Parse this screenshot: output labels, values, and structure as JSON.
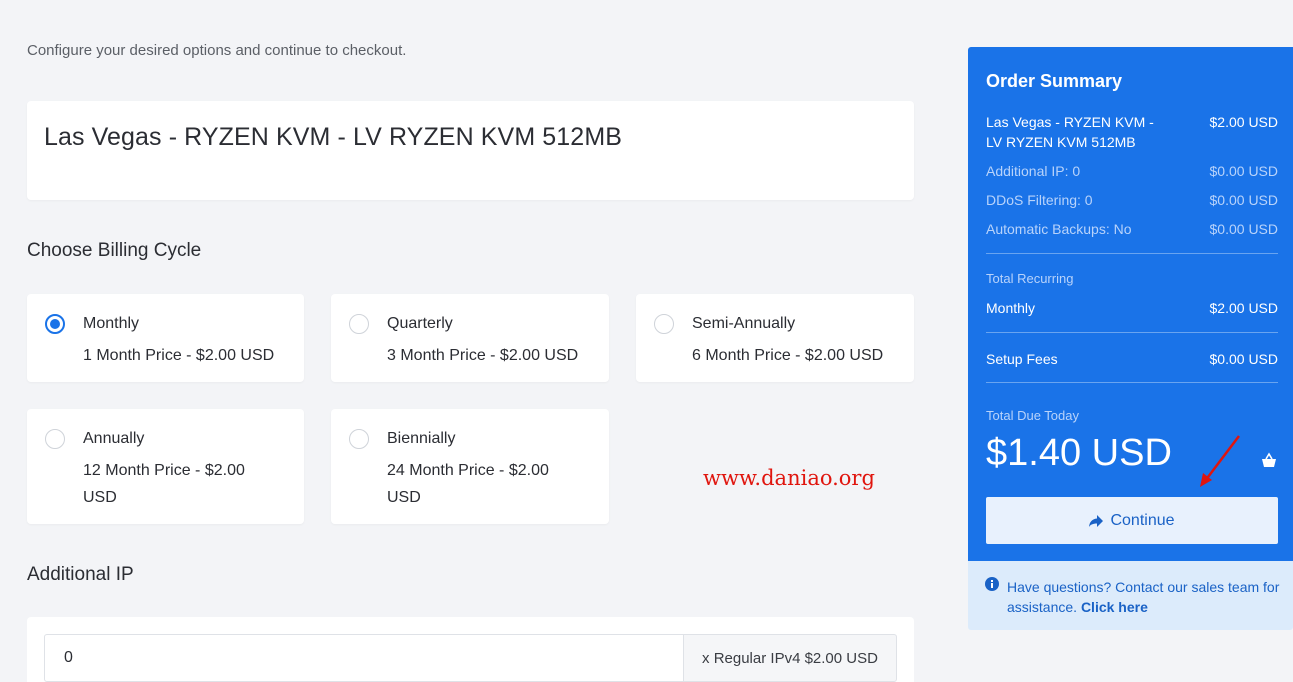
{
  "intro": "Configure your desired options and continue to checkout.",
  "product": {
    "title": "Las Vegas - RYZEN KVM - LV RYZEN KVM 512MB"
  },
  "billing": {
    "heading": "Choose Billing Cycle",
    "options": [
      {
        "name": "Monthly",
        "price": "1 Month Price - $2.00 USD",
        "selected": true
      },
      {
        "name": "Quarterly",
        "price": "3 Month Price - $2.00 USD",
        "selected": false
      },
      {
        "name": "Semi-Annually",
        "price": "6 Month Price - $2.00 USD",
        "selected": false
      },
      {
        "name": "Annually",
        "price": "12 Month Price - $2.00 USD",
        "selected": false
      },
      {
        "name": "Biennially",
        "price": "24 Month Price - $2.00 USD",
        "selected": false
      }
    ]
  },
  "watermark": "www.daniao.org",
  "additional_ip": {
    "heading": "Additional IP",
    "value": "0",
    "addon": "x Regular IPv4 $2.00 USD"
  },
  "summary": {
    "heading": "Order Summary",
    "product_line": {
      "label": "Las Vegas - RYZEN KVM - LV RYZEN KVM 512MB",
      "value": "$2.00 USD"
    },
    "options": [
      {
        "label": "Additional IP: 0",
        "value": "$0.00 USD"
      },
      {
        "label": "DDoS Filtering: 0",
        "value": "$0.00 USD"
      },
      {
        "label": "Automatic Backups: No",
        "value": "$0.00 USD"
      }
    ],
    "recurring_label": "Total Recurring",
    "recurring": {
      "label": "Monthly",
      "value": "$2.00 USD"
    },
    "setup": {
      "label": "Setup Fees",
      "value": "$0.00 USD"
    },
    "due_label": "Total Due Today",
    "total": "$1.40 USD",
    "continue": "Continue"
  },
  "help": {
    "text": "Have questions? Contact our sales team for assistance.",
    "link": "Click here"
  },
  "colors": {
    "accent": "#1a73e8",
    "panel_light": "#dcebfb",
    "watermark": "#e0150e"
  },
  "icons": {
    "cart": "cart-icon",
    "continue": "arrow-right-icon",
    "help": "info-circle-icon"
  }
}
